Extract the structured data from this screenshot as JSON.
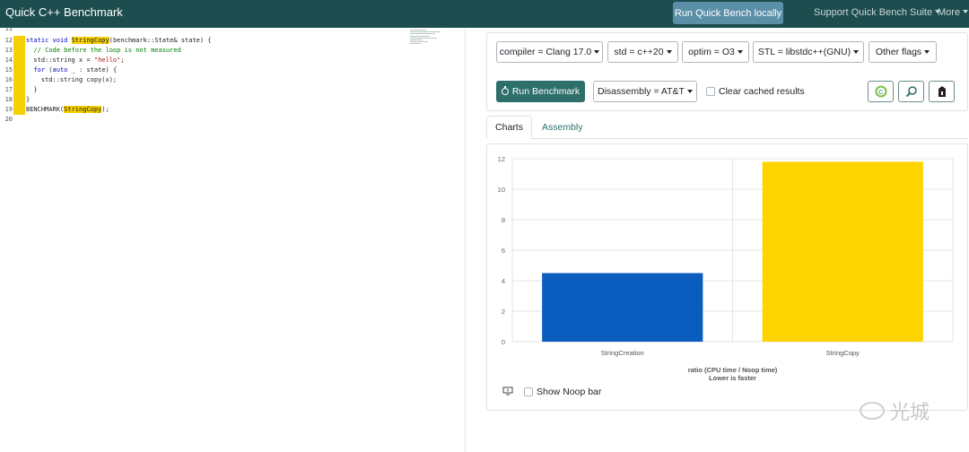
{
  "navbar": {
    "brand": "Quick C++ Benchmark",
    "run_locally": "Run Quick Bench locally",
    "support": "Support Quick Bench Suite",
    "more": "More"
  },
  "editor": {
    "lines": [
      {
        "n": "11",
        "text": ""
      },
      {
        "n": "12",
        "text": "static void StringCopy(benchmark::State& state) {"
      },
      {
        "n": "13",
        "text": "  // Code before the loop is not measured"
      },
      {
        "n": "14",
        "text": "  std::string x = \"hello\";"
      },
      {
        "n": "15",
        "text": "  for (auto _ : state) {"
      },
      {
        "n": "16",
        "text": "    std::string copy(x);"
      },
      {
        "n": "17",
        "text": "  }"
      },
      {
        "n": "18",
        "text": "}"
      },
      {
        "n": "19",
        "text": "BENCHMARK(StringCopy);"
      },
      {
        "n": "20",
        "text": ""
      }
    ]
  },
  "options": {
    "compiler": "compiler = Clang 17.0",
    "std": "std = c++20",
    "optim": "optim = O3",
    "stl": "STL = libstdc++(GNU)",
    "other_flags": "Other flags",
    "run_benchmark": "Run Benchmark",
    "disassembly": "Disassembly = AT&T",
    "clear_cached": "Clear cached results"
  },
  "tabs": {
    "charts": "Charts",
    "assembly": "Assembly"
  },
  "chart_data": {
    "type": "bar",
    "categories": [
      "StringCreation",
      "StringCopy"
    ],
    "values": [
      4.5,
      11.8
    ],
    "colors": [
      "#0b5cbf",
      "#ffd500"
    ],
    "xlabel": "ratio (CPU time / Noop time)",
    "xlabel2": "Lower is faster",
    "ylim": [
      0,
      12
    ],
    "yticks": [
      0,
      2,
      4,
      6,
      8,
      10,
      12
    ],
    "grid": true
  },
  "show_noop": "Show Noop bar",
  "watermark": "光城"
}
